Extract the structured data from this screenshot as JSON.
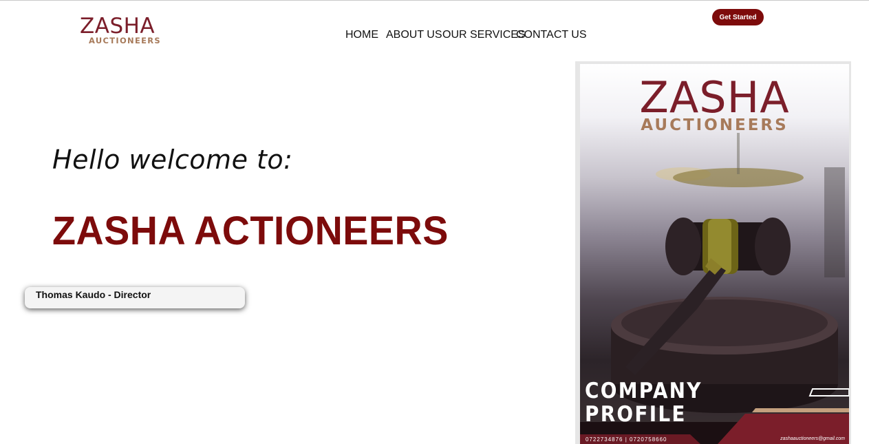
{
  "header": {
    "logo_main": "ZASHA",
    "logo_sub": "AUCTIONEERS",
    "nav": {
      "home": "HOME",
      "about": "ABOUT US",
      "services": "OUR SERVICES",
      "contact": "CONTACT US"
    },
    "cta_label": "Get Started"
  },
  "hero": {
    "greeting": "Hello welcome to:",
    "title": "ZASHA ACTIONEERS",
    "director": "Thomas Kaudo - Director"
  },
  "brochure": {
    "logo_main": "ZASHA",
    "logo_sub": "AUCTIONEERS",
    "profile_line1": "COMPANY",
    "profile_line2": "PROFILE",
    "phone": "0722734876 | 0720758660",
    "email": "zashaauctioneers@gmail.com"
  },
  "colors": {
    "brand_maroon": "#7d0b0b",
    "logo_maroon": "#7b1e2a",
    "logo_tan": "#a77a5a"
  }
}
